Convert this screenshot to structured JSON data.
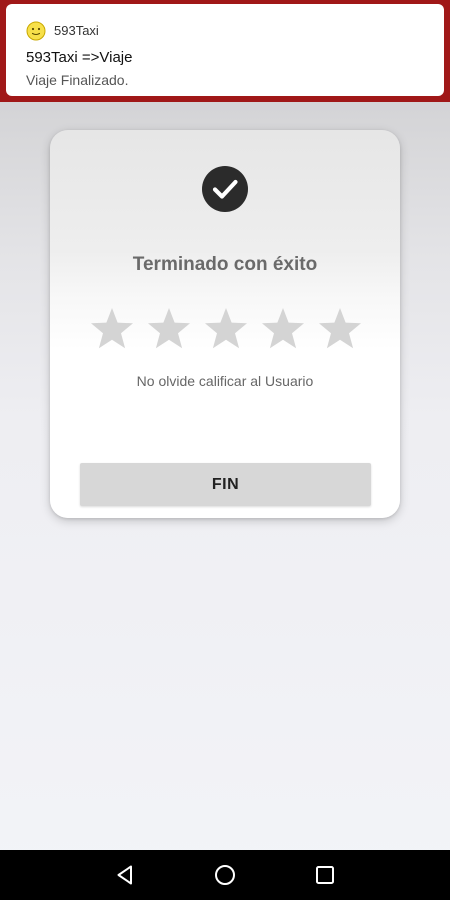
{
  "notification": {
    "app_name": "593Taxi",
    "title": "593Taxi =>Viaje",
    "text": "Viaje Finalizado."
  },
  "card": {
    "title": "Terminado con éxito",
    "rating": {
      "max": 5,
      "value": 0
    },
    "subtitle": "No olvide calificar al Usuario",
    "button_label": "FIN"
  },
  "colors": {
    "notification_frame": "#a01818",
    "check_circle": "#2b2b2b",
    "star_empty": "#d4d4d4",
    "button_bg": "#d7d7d7",
    "navbar": "#000000"
  },
  "icons": {
    "app": "smiley-icon",
    "success": "check-circle-icon",
    "rating": "star-icon",
    "nav": [
      "back-icon",
      "home-icon",
      "recents-icon"
    ]
  }
}
